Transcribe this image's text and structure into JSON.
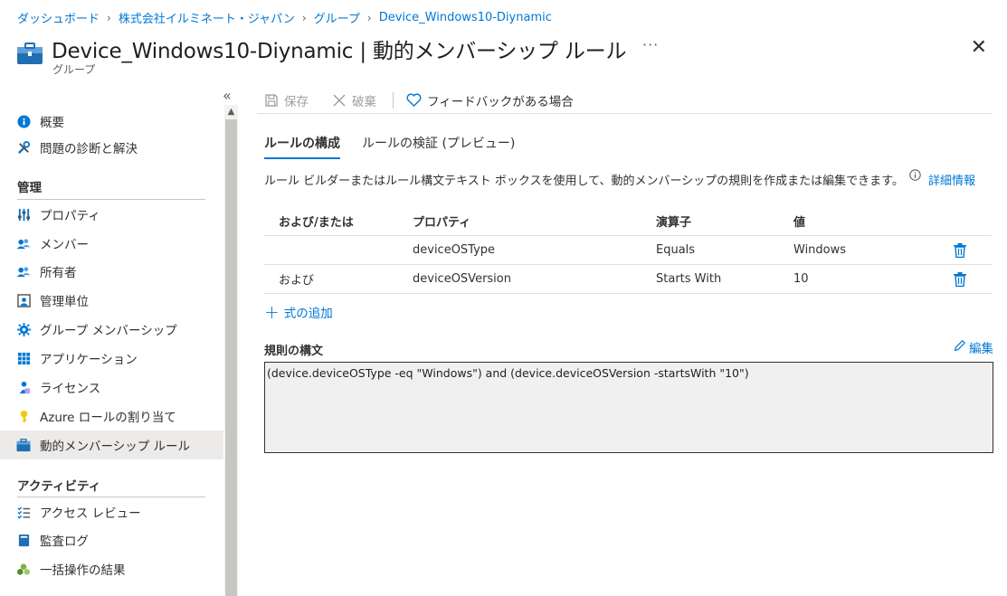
{
  "breadcrumb": [
    "ダッシュボード",
    "株式会社イルミネート・ジャパン",
    "グループ",
    "Device_Windows10-Diynamic"
  ],
  "header": {
    "title": "Device_Windows10-Diynamic | 動的メンバーシップ ルール",
    "subtitle": "グループ",
    "more": "···",
    "close": "✕"
  },
  "sidebar": {
    "collapse": "«",
    "top_items": [
      {
        "label": "概要",
        "icon": "info-icon"
      },
      {
        "label": "問題の診断と解決",
        "icon": "wrench-icon"
      }
    ],
    "section_manage": "管理",
    "manage_items": [
      {
        "label": "プロパティ",
        "icon": "properties-icon"
      },
      {
        "label": "メンバー",
        "icon": "members-icon"
      },
      {
        "label": "所有者",
        "icon": "owners-icon"
      },
      {
        "label": "管理単位",
        "icon": "admin-units-icon"
      },
      {
        "label": "グループ メンバーシップ",
        "icon": "group-membership-icon"
      },
      {
        "label": "アプリケーション",
        "icon": "applications-icon"
      },
      {
        "label": "ライセンス",
        "icon": "licenses-icon"
      },
      {
        "label": "Azure ロールの割り当て",
        "icon": "key-icon"
      },
      {
        "label": "動的メンバーシップ ルール",
        "icon": "dynamic-rule-icon"
      }
    ],
    "section_activity": "アクティビティ",
    "activity_items": [
      {
        "label": "アクセス レビュー",
        "icon": "access-review-icon"
      },
      {
        "label": "監査ログ",
        "icon": "audit-log-icon"
      },
      {
        "label": "一括操作の結果",
        "icon": "bulk-results-icon"
      }
    ]
  },
  "toolbar": {
    "save": "保存",
    "discard": "破棄",
    "feedback": "フィードバックがある場合"
  },
  "tabs": [
    "ルールの構成",
    "ルールの検証 (プレビュー)"
  ],
  "description": "ルール ビルダーまたはルール構文テキスト ボックスを使用して、動的メンバーシップの規則を作成または編集できます。",
  "detail_link": "詳細情報",
  "table": {
    "headers": [
      "および/または",
      "プロパティ",
      "演算子",
      "値"
    ],
    "rows": [
      {
        "andor": "",
        "property": "deviceOSType",
        "operator": "Equals",
        "value": "Windows"
      },
      {
        "andor": "および",
        "property": "deviceOSVersion",
        "operator": "Starts With",
        "value": "10"
      }
    ]
  },
  "add_expression": "式の追加",
  "syntax": {
    "label": "規則の構文",
    "edit": "編集",
    "text": "(device.deviceOSType -eq \"Windows\") and (device.deviceOSVersion -startsWith \"10\")"
  },
  "colors": {
    "accent": "#0078d4",
    "active_bg": "#edebe9"
  }
}
